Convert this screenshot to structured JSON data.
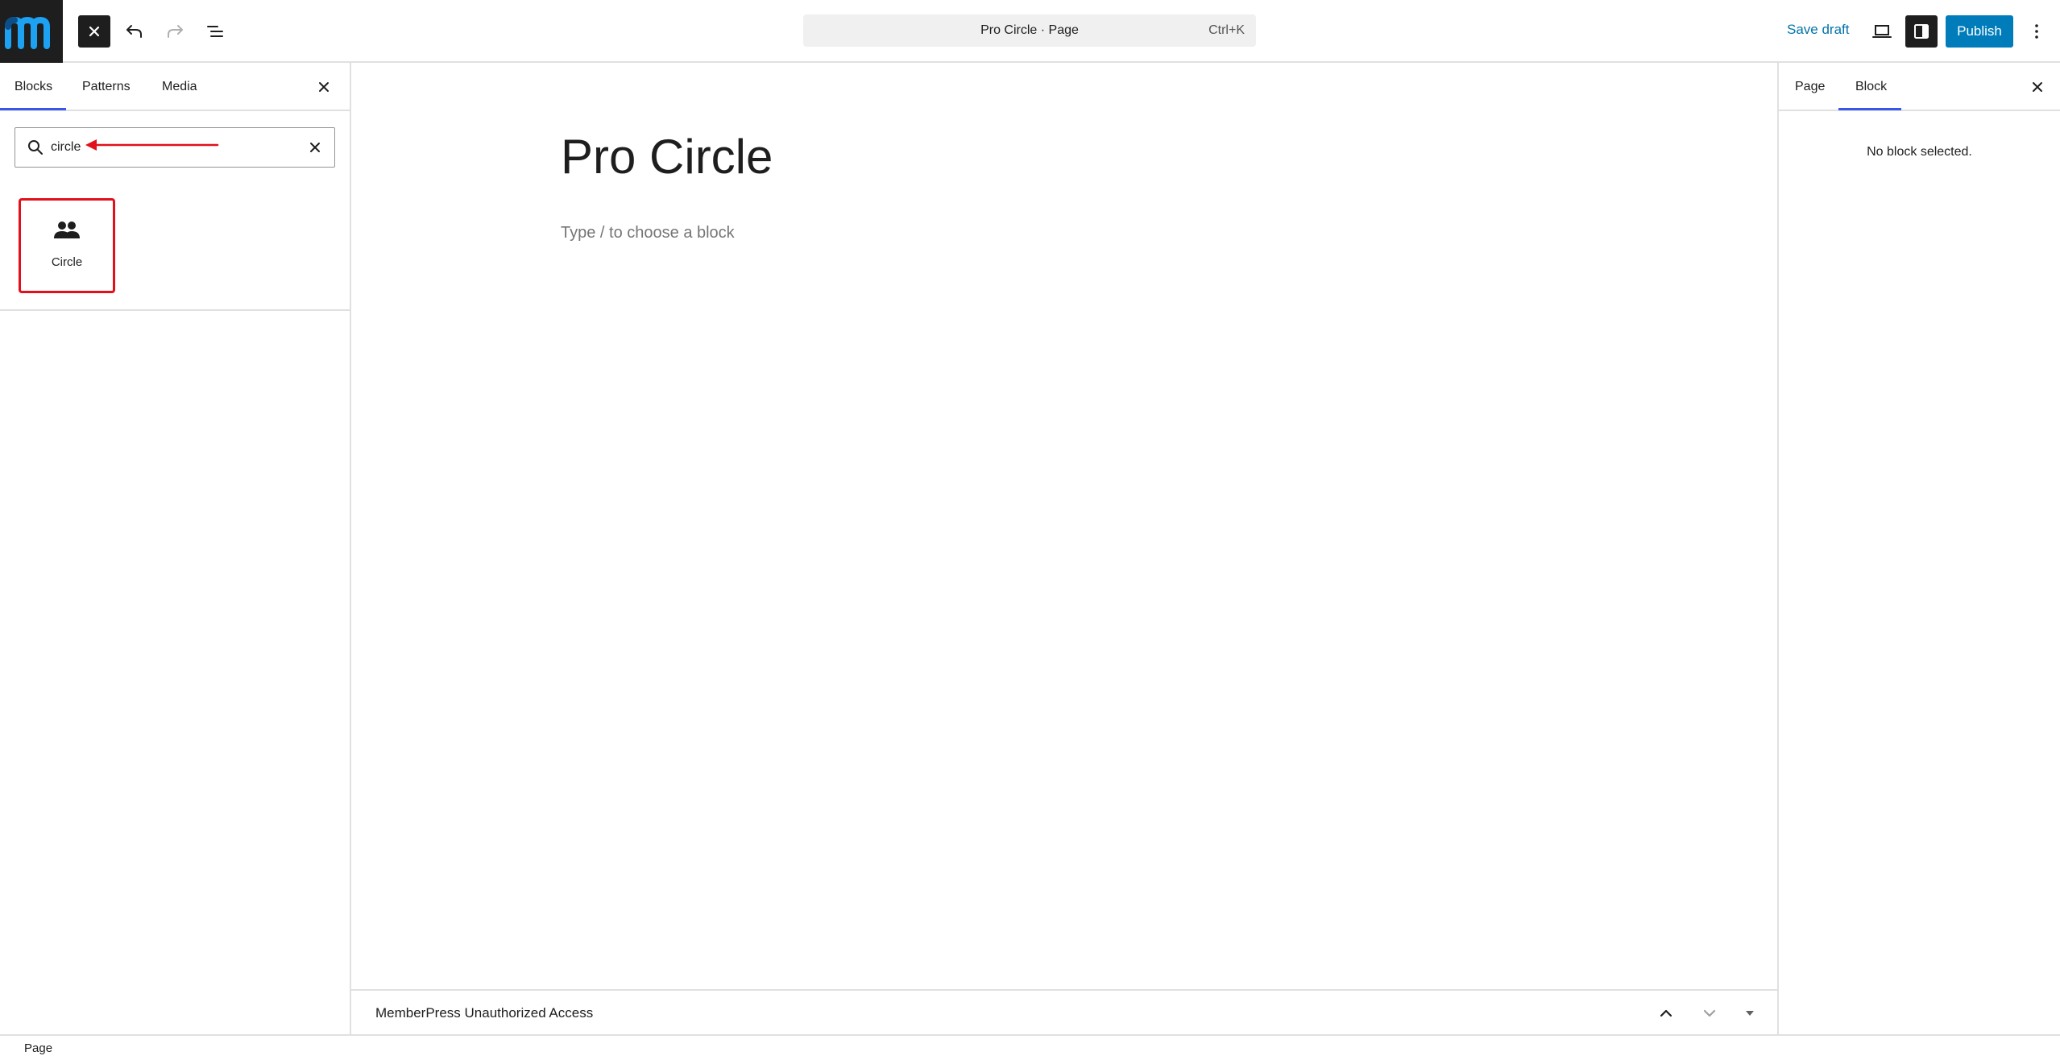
{
  "toolbar": {
    "document_title": "Pro Circle · Page",
    "shortcut": "Ctrl+K",
    "save_draft": "Save draft",
    "publish": "Publish"
  },
  "inserter": {
    "tabs": [
      "Blocks",
      "Patterns",
      "Media"
    ],
    "active_tab": "Blocks",
    "search_value": "circle",
    "results": [
      {
        "label": "Circle",
        "icon": "people-icon"
      }
    ]
  },
  "editor": {
    "title": "Pro Circle",
    "placeholder": "Type / to choose a block"
  },
  "metabox": {
    "title": "MemberPress Unauthorized Access"
  },
  "settings": {
    "tabs": [
      "Page",
      "Block"
    ],
    "active_tab": "Block",
    "empty_message": "No block selected."
  },
  "footer": {
    "breadcrumb": "Page"
  },
  "colors": {
    "accent": "#007cba",
    "tab_underline": "#3858e9",
    "annotation_red": "#e2101b",
    "logo_bg": "#1e1e1e",
    "logo_mark": "#1da1f2"
  }
}
